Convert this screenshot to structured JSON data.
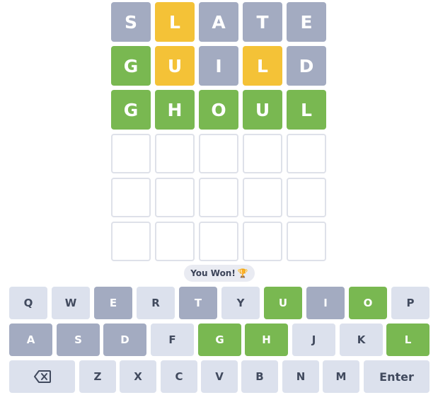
{
  "board": {
    "rows": [
      [
        {
          "letter": "S",
          "state": "gray"
        },
        {
          "letter": "L",
          "state": "yellow"
        },
        {
          "letter": "A",
          "state": "gray"
        },
        {
          "letter": "T",
          "state": "gray"
        },
        {
          "letter": "E",
          "state": "gray"
        }
      ],
      [
        {
          "letter": "G",
          "state": "green"
        },
        {
          "letter": "U",
          "state": "yellow"
        },
        {
          "letter": "I",
          "state": "gray"
        },
        {
          "letter": "L",
          "state": "yellow"
        },
        {
          "letter": "D",
          "state": "gray"
        }
      ],
      [
        {
          "letter": "G",
          "state": "green"
        },
        {
          "letter": "H",
          "state": "green"
        },
        {
          "letter": "O",
          "state": "green"
        },
        {
          "letter": "U",
          "state": "green"
        },
        {
          "letter": "L",
          "state": "green"
        }
      ],
      [
        {
          "letter": "",
          "state": "empty"
        },
        {
          "letter": "",
          "state": "empty"
        },
        {
          "letter": "",
          "state": "empty"
        },
        {
          "letter": "",
          "state": "empty"
        },
        {
          "letter": "",
          "state": "empty"
        }
      ],
      [
        {
          "letter": "",
          "state": "empty"
        },
        {
          "letter": "",
          "state": "empty"
        },
        {
          "letter": "",
          "state": "empty"
        },
        {
          "letter": "",
          "state": "empty"
        },
        {
          "letter": "",
          "state": "empty"
        }
      ],
      [
        {
          "letter": "",
          "state": "empty"
        },
        {
          "letter": "",
          "state": "empty"
        },
        {
          "letter": "",
          "state": "empty"
        },
        {
          "letter": "",
          "state": "empty"
        },
        {
          "letter": "",
          "state": "empty"
        }
      ]
    ]
  },
  "toast": {
    "text": "You Won!",
    "icon": "trophy-icon"
  },
  "keyboard": {
    "row1": [
      {
        "label": "Q",
        "state": "default"
      },
      {
        "label": "W",
        "state": "default"
      },
      {
        "label": "E",
        "state": "gray"
      },
      {
        "label": "R",
        "state": "default"
      },
      {
        "label": "T",
        "state": "gray"
      },
      {
        "label": "Y",
        "state": "default"
      },
      {
        "label": "U",
        "state": "green"
      },
      {
        "label": "I",
        "state": "gray"
      },
      {
        "label": "O",
        "state": "green"
      },
      {
        "label": "P",
        "state": "default"
      }
    ],
    "row2": [
      {
        "label": "A",
        "state": "gray"
      },
      {
        "label": "S",
        "state": "gray"
      },
      {
        "label": "D",
        "state": "gray"
      },
      {
        "label": "F",
        "state": "default"
      },
      {
        "label": "G",
        "state": "green"
      },
      {
        "label": "H",
        "state": "green"
      },
      {
        "label": "J",
        "state": "default"
      },
      {
        "label": "K",
        "state": "default"
      },
      {
        "label": "L",
        "state": "green"
      }
    ],
    "row3": [
      {
        "label": "",
        "state": "default",
        "icon": "backspace-icon"
      },
      {
        "label": "Z",
        "state": "default"
      },
      {
        "label": "X",
        "state": "default"
      },
      {
        "label": "C",
        "state": "default"
      },
      {
        "label": "V",
        "state": "default"
      },
      {
        "label": "B",
        "state": "default"
      },
      {
        "label": "N",
        "state": "default"
      },
      {
        "label": "M",
        "state": "default"
      },
      {
        "label": "Enter",
        "state": "default"
      }
    ]
  },
  "colors": {
    "absent": "#a3abc1",
    "present": "#f4c237",
    "correct": "#79b851",
    "key_default": "#dce1ed",
    "empty_border": "#dee1e9"
  }
}
